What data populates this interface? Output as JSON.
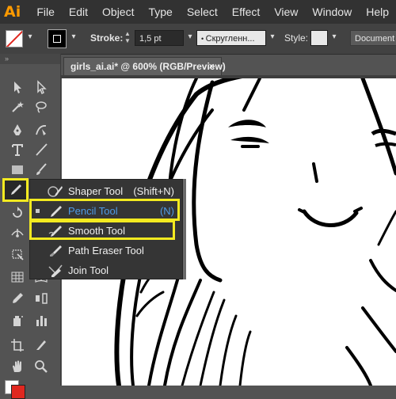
{
  "app": {
    "logo": "Ai"
  },
  "menu": [
    "File",
    "Edit",
    "Object",
    "Type",
    "Select",
    "Effect",
    "View",
    "Window",
    "Help"
  ],
  "control_bar": {
    "fill": "none",
    "stroke_label": "Stroke:",
    "stroke_value": "1,5 pt",
    "brush_value": "Скругленн...",
    "style_label": "Style:",
    "document_button": "Document"
  },
  "document_tab": {
    "title": "girls_ai.ai* @ 600% (RGB/Preview)",
    "close": "×"
  },
  "tools": [
    "selection-tool",
    "direct-selection-tool",
    "magic-wand-tool",
    "lasso-tool",
    "pen-tool",
    "curvature-tool",
    "type-tool",
    "line-tool",
    "rectangle-tool",
    "paintbrush-tool",
    "pencil-tool",
    "eraser-tool",
    "rotate-tool",
    "scale-tool",
    "width-tool",
    "free-transform-tool",
    "shape-builder-tool",
    "perspective-grid-tool",
    "mesh-tool",
    "gradient-tool",
    "eyedropper-tool",
    "blend-tool",
    "symbol-sprayer-tool",
    "column-graph-tool",
    "artboard-tool",
    "slice-tool",
    "hand-tool",
    "zoom-tool"
  ],
  "flyout": {
    "items": [
      {
        "label": "Shaper Tool",
        "shortcut": "(Shift+N)",
        "icon": "shaper-icon",
        "selected": false
      },
      {
        "label": "Pencil Tool",
        "shortcut": "(N)",
        "icon": "pencil-icon",
        "selected": true
      },
      {
        "label": "Smooth Tool",
        "shortcut": "",
        "icon": "smooth-icon",
        "selected": false
      },
      {
        "label": "Path Eraser Tool",
        "shortcut": "",
        "icon": "path-eraser-icon",
        "selected": false
      },
      {
        "label": "Join Tool",
        "shortcut": "",
        "icon": "join-icon",
        "selected": false
      }
    ],
    "highlight_color": "#f3ea20",
    "selected_color": "#4f9be7"
  }
}
